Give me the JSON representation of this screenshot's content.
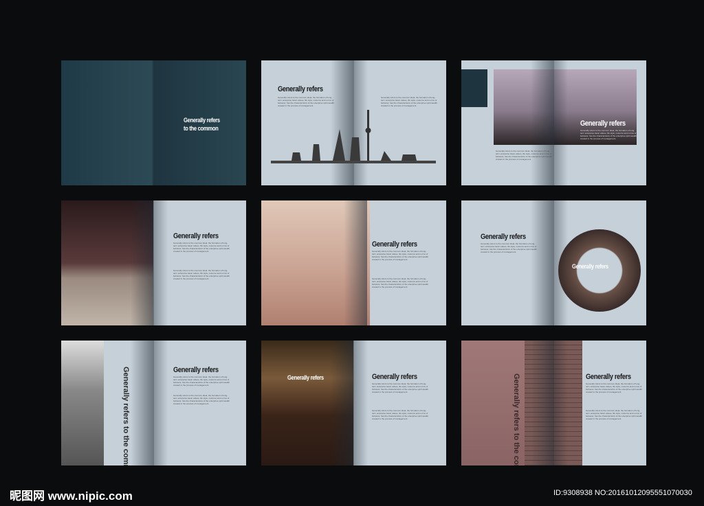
{
  "heading": "Generally refers",
  "cover_title_line1": "Generally refers",
  "cover_title_line2": "to the common",
  "vertical_title": "Generally refers to the common",
  "body_text": "Generally refers to the common ideal, the formation of long-term enterprise basic values, life style, customs and norms of behavior, has the characteristics of the enterprise spirit wealth created in the process of management.",
  "watermark": {
    "logo": "昵图网",
    "site": "www.nipic.com",
    "id": "ID:9308938 NO:20161012095551070030"
  }
}
